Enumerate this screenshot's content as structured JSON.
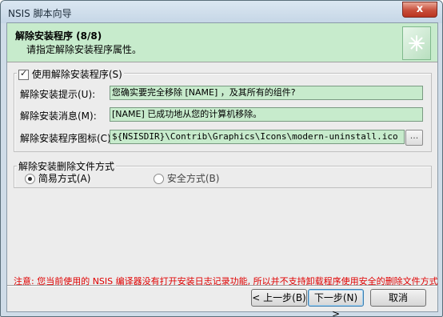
{
  "window": {
    "title": "NSIS 脚本向导",
    "close_label": "x"
  },
  "header": {
    "title": "解除安装程序 (8/8)",
    "subtitle": "请指定解除安装程序属性。",
    "image_icon": "wizard-sparkle-icon"
  },
  "uninstall_group": {
    "enable_checkbox_label": "使用解除安装程序(S)",
    "enable_checked": true,
    "prompt_label": "解除安装提示(U):",
    "prompt_value": "您确实要完全移除 [NAME] ，及其所有的组件?",
    "message_label": "解除安装消息(M):",
    "message_value": "[NAME] 已成功地从您的计算机移除。",
    "icon_label": "解除安装程序图标(C):",
    "icon_value": "${NSISDIR}\\Contrib\\Graphics\\Icons\\modern-uninstall.ico",
    "browse_label": "..."
  },
  "delete_mode_group": {
    "legend": "解除安装删除文件方式",
    "options": [
      {
        "label": "简易方式(A)",
        "selected": true
      },
      {
        "label": "安全方式(B)",
        "selected": false
      }
    ]
  },
  "note": "注意: 您当前使用的 NSIS 编译器没有打开安装日志记录功能, 所以并不支持卸载程序使用安全的删除文件方式",
  "buttons": {
    "back": "< 上一步(B)",
    "next": "下一步(N) >",
    "cancel": "取消"
  },
  "colors": {
    "accent_field": "#c7ebcc",
    "note_text": "#e00000"
  }
}
